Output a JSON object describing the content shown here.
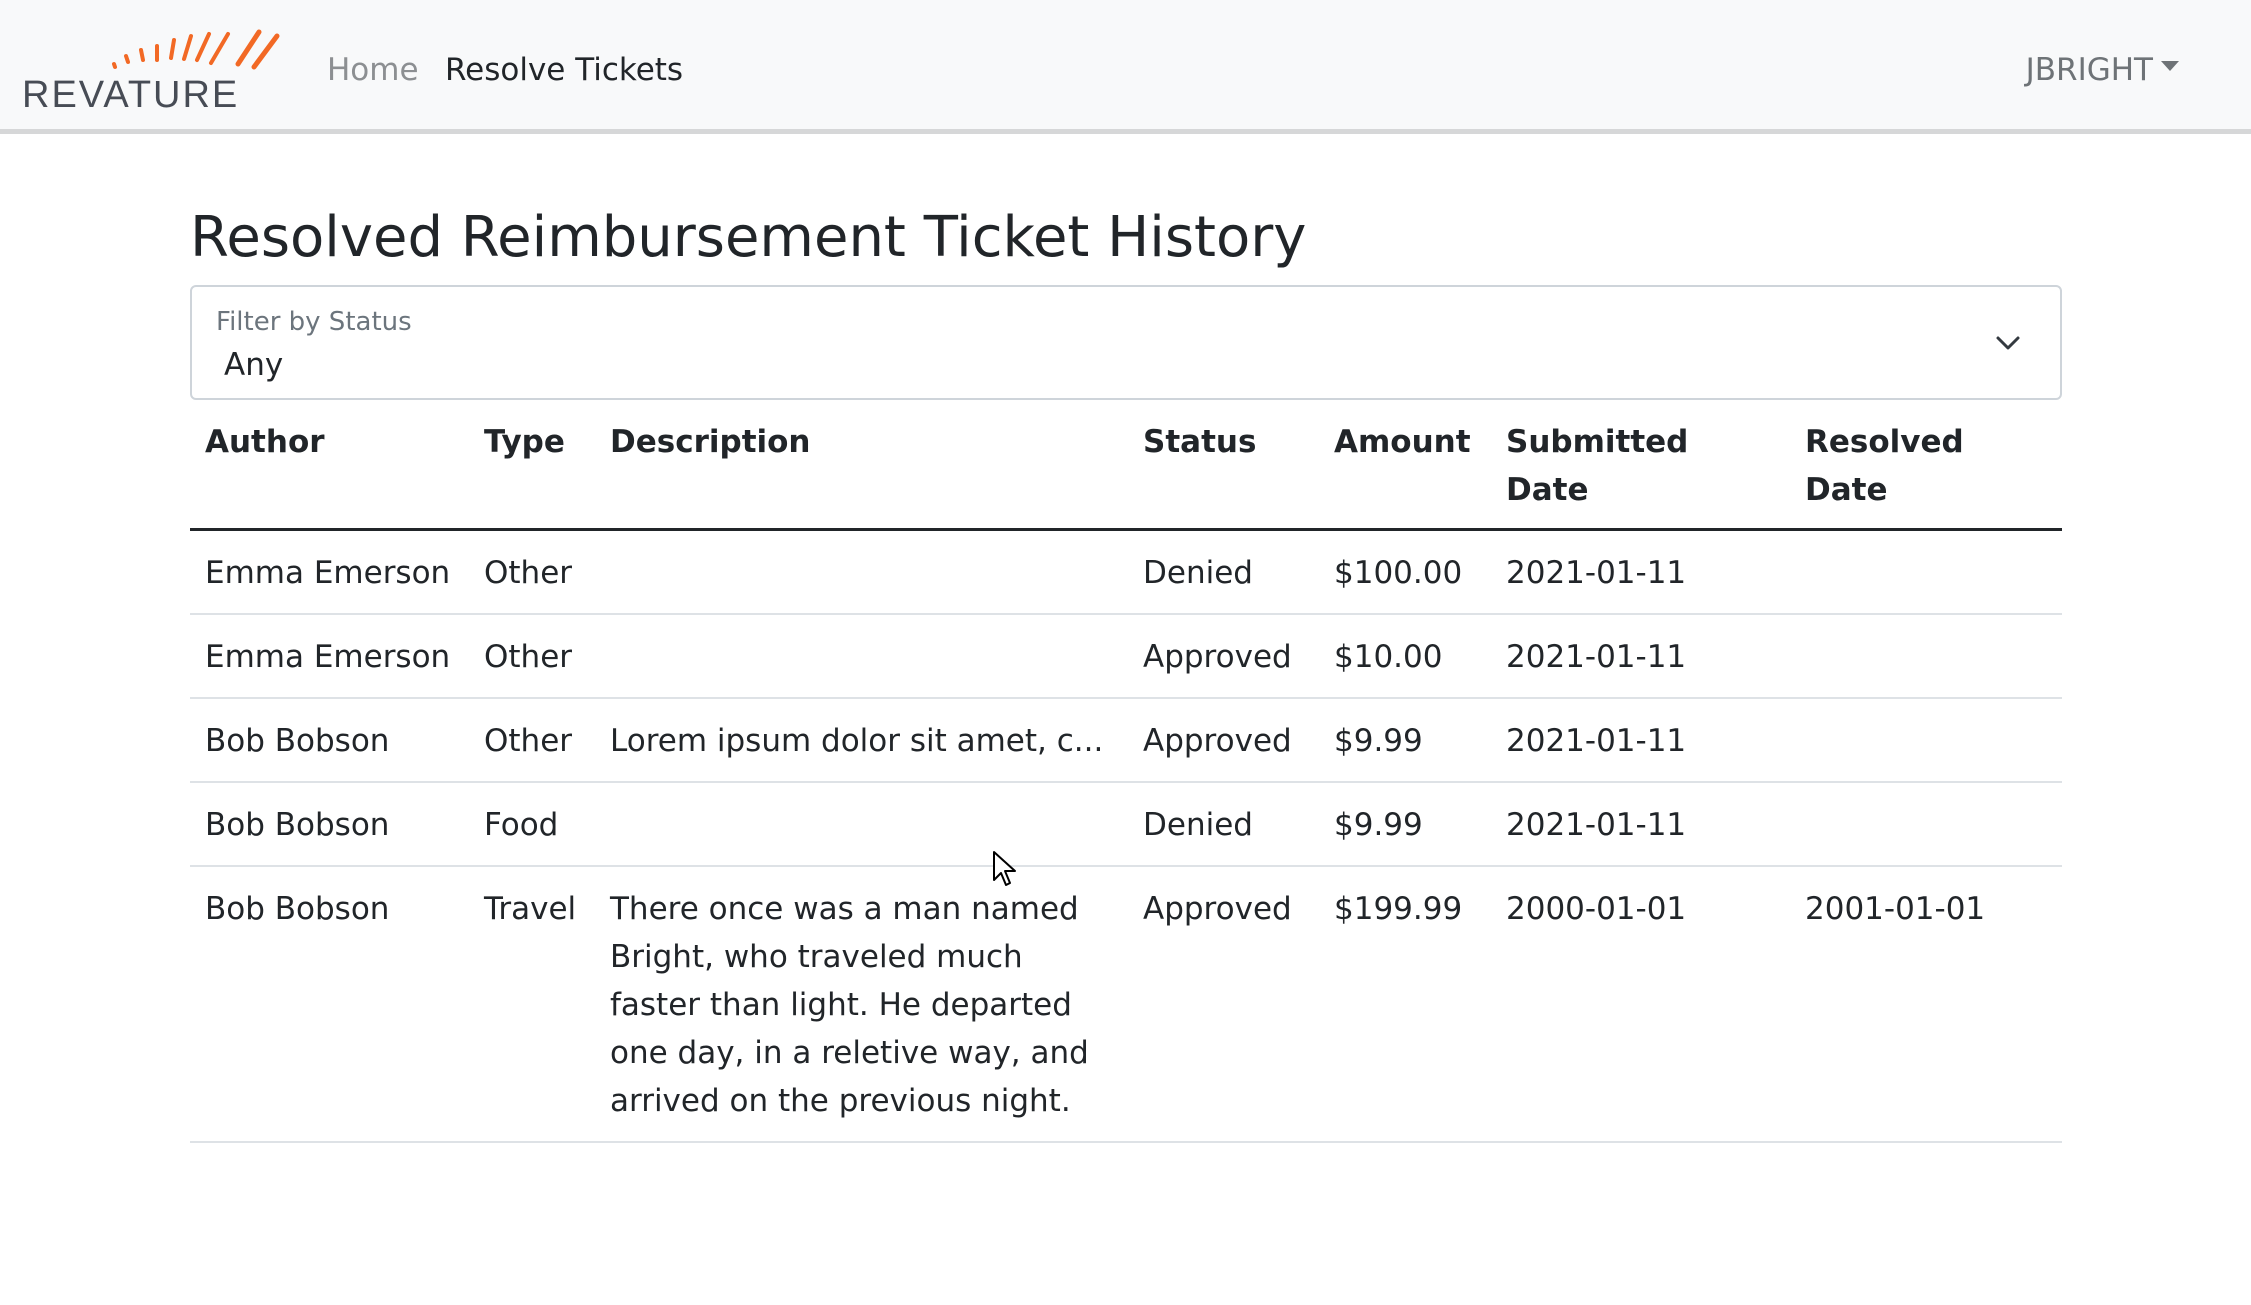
{
  "navbar": {
    "brand_text": "REVATURE",
    "links": [
      {
        "label": "Home",
        "active": false
      },
      {
        "label": "Resolve Tickets",
        "active": true
      }
    ],
    "user": "JBRIGHT",
    "brand_colors": {
      "text": "#474c55",
      "rays": "#f26925"
    }
  },
  "main": {
    "title": "Resolved Reimbursement Ticket History",
    "filter": {
      "label": "Filter by Status",
      "value": "Any"
    },
    "table": {
      "columns": [
        "Author",
        "Type",
        "Description",
        "Status",
        "Amount",
        "Submitted Date",
        "Resolved Date"
      ],
      "rows": [
        [
          "Emma Emerson",
          "Other",
          "",
          "Denied",
          "$100.00",
          "2021-01-11",
          ""
        ],
        [
          "Emma Emerson",
          "Other",
          "",
          "Approved",
          "$10.00",
          "2021-01-11",
          ""
        ],
        [
          "Bob Bobson",
          "Other",
          "Lorem ipsum dolor sit amet, c...",
          "Approved",
          "$9.99",
          "2021-01-11",
          ""
        ],
        [
          "Bob Bobson",
          "Food",
          "",
          "Denied",
          "$9.99",
          "2021-01-11",
          ""
        ],
        [
          "Bob Bobson",
          "Travel",
          "There once was a man named Bright, who traveled much faster than light. He departed one day, in a reletive way, and arrived on the previous night.",
          "Approved",
          "$199.99",
          "2000-01-01",
          "2001-01-01"
        ]
      ]
    }
  }
}
